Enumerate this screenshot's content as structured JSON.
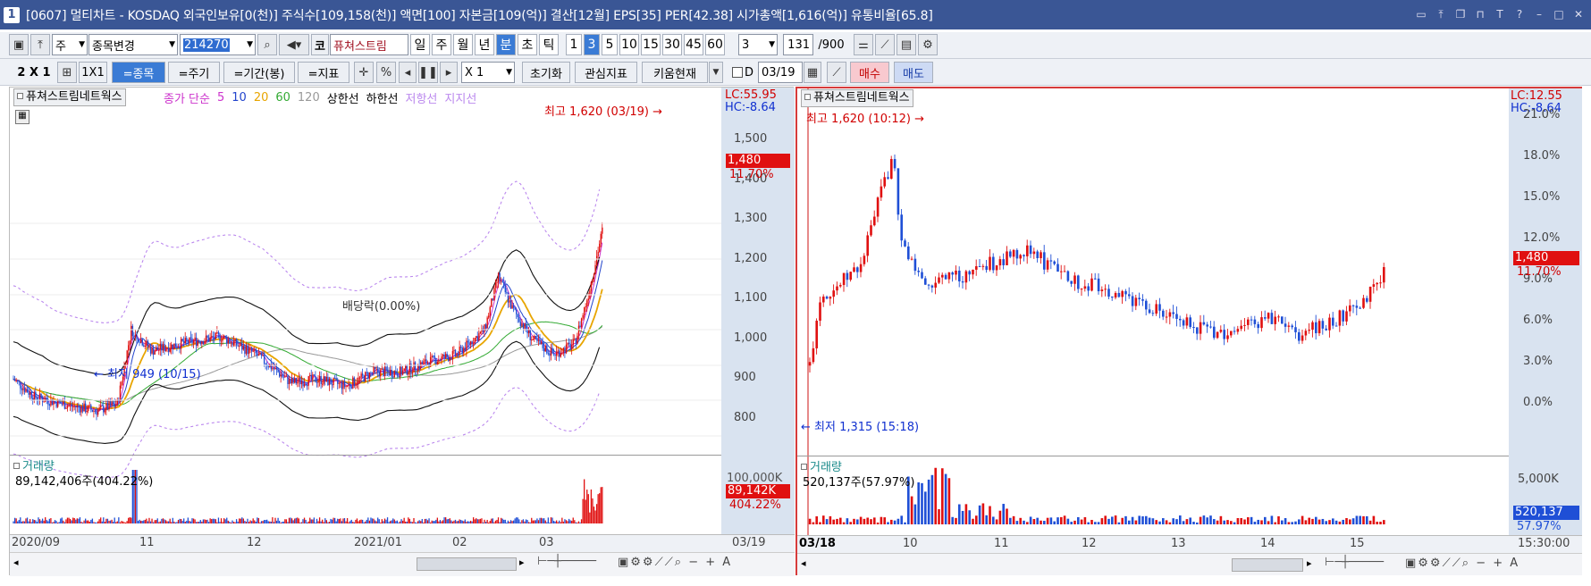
{
  "window": {
    "number": "1",
    "title": "[0607] 멀티차트 - KOSDAQ 외국인보유[0(천)] 주식수[109,158(천)] 액면[100] 자본금[109(억)] 결산[12월] EPS[35] PER[42.38] 시가총액[1,616(억)] 유통비율[65.8]"
  },
  "toolbar1": {
    "type_select": "주",
    "stock_change": "종목변경",
    "stock_code": "214270",
    "market_btn": "코",
    "stock_name": "퓨쳐스트림",
    "periods": [
      "일",
      "주",
      "월",
      "년",
      "분",
      "초",
      "틱"
    ],
    "selected_period": "분",
    "minute_options": [
      "1",
      "3",
      "5",
      "10",
      "15",
      "30",
      "45",
      "60"
    ],
    "selected_minute": "3",
    "interval_value": "3",
    "count_value": "131",
    "count_max": "/900"
  },
  "toolbar2": {
    "layout_label": "2 X 1",
    "one_by_one": "1X1",
    "stock_btn": "=종목",
    "cycle_btn": "=주기",
    "range_btn": "=기간(봉)",
    "indicator_btn": "=지표",
    "percent": "%",
    "multiplier": "X 1",
    "reset": "초기화",
    "watch_indicator": "관심지표",
    "kiwoom_now": "키움현재",
    "d_label": "D",
    "date_value": "03/19",
    "buy": "매수",
    "sell": "매도"
  },
  "left_chart": {
    "stock_label": "퓨쳐스트림네트웍스",
    "legend": [
      {
        "text": "종가 단순",
        "color": "#cc33cc"
      },
      {
        "text": "5",
        "color": "#cc33cc"
      },
      {
        "text": "10",
        "color": "#2244cc"
      },
      {
        "text": "20",
        "color": "#e8a500"
      },
      {
        "text": "60",
        "color": "#33aa33"
      },
      {
        "text": "120",
        "color": "#999999"
      },
      {
        "text": "상한선",
        "color": "#000000"
      },
      {
        "text": "하한선",
        "color": "#000000"
      },
      {
        "text": "저항선",
        "color": "#bb88ee"
      },
      {
        "text": "지지선",
        "color": "#bb88ee"
      }
    ],
    "high_annotation": "최고 1,620 (03/19)",
    "low_annotation": "최저 949 (10/15)",
    "event_annotation": "배당락(0.00%)",
    "lc": "LC:55.95",
    "hc": "HC:-8.64",
    "price_axis": [
      "1,500",
      "1,400",
      "1,300",
      "1,200",
      "1,100",
      "1,000",
      "900",
      "800"
    ],
    "current_price": "1,480",
    "current_change": "11.70%",
    "volume_title": "거래량",
    "volume_value": "89,142,406주(404.22%)",
    "volume_axis_top": "100,000K",
    "volume_tag": "89,142K",
    "volume_tag_pct": "404.22%",
    "x_axis": [
      "2020/09",
      "11",
      "12",
      "2021/01",
      "02",
      "03"
    ],
    "x_end": "03/19",
    "chart_data": {
      "type": "candlestick",
      "start_price": 1050,
      "low": 949,
      "high": 1620,
      "last": 1480
    }
  },
  "right_chart": {
    "stock_label": "퓨쳐스트림네트웍스",
    "high_annotation": "최고 1,620 (10:12)",
    "low_annotation": "최저 1,315 (15:18)",
    "lc": "LC:12.55",
    "hc": "HC:-8.64",
    "pct_axis": [
      "21.0%",
      "18.0%",
      "15.0%",
      "12.0%",
      "9.0%",
      "6.0%",
      "3.0%",
      "0.0%"
    ],
    "current_price": "1,480",
    "current_change": "11.70%",
    "volume_title": "거래량",
    "volume_value": "520,137주(57.97%)",
    "volume_axis_top": "5,000K",
    "volume_tag": "520,137",
    "volume_tag_pct": "57.97%",
    "x_axis": [
      "03/18",
      "10",
      "11",
      "12",
      "13",
      "14",
      "15"
    ],
    "x_end": "15:30:00",
    "chart_data": {
      "type": "candlestick",
      "low": 1315,
      "high": 1620,
      "last": 1480
    }
  }
}
